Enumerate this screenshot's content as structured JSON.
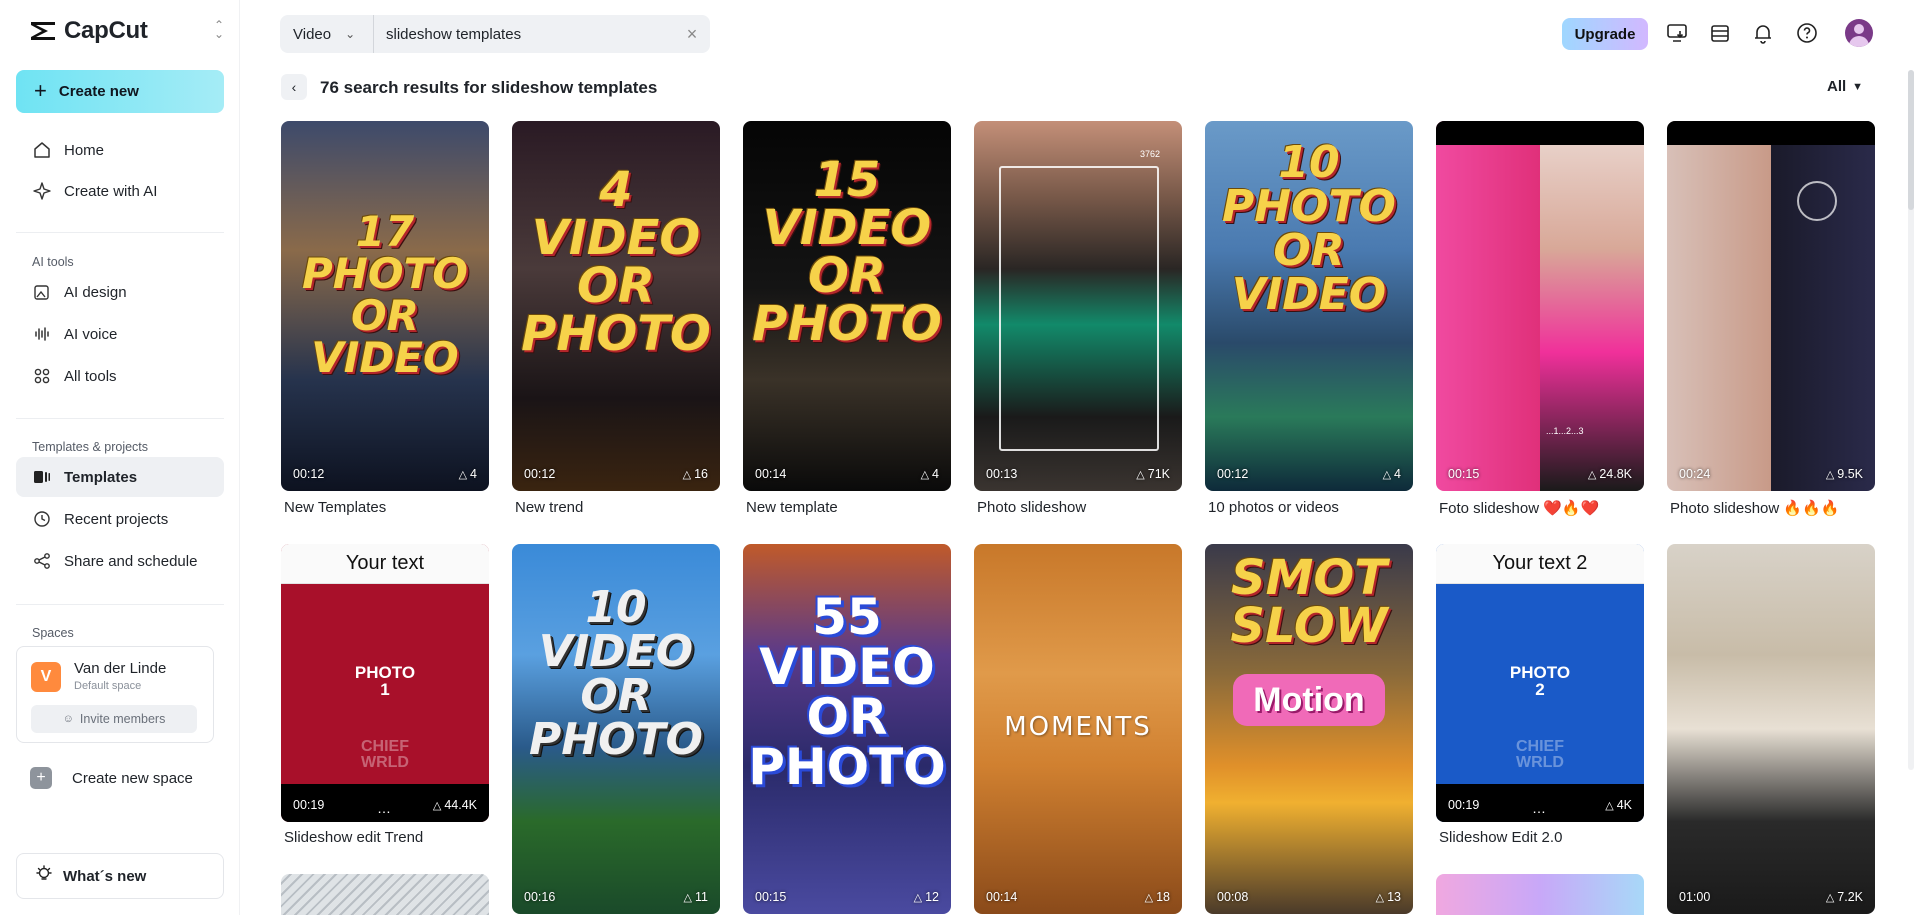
{
  "app": {
    "name": "CapCut",
    "colors": {
      "accent_cyan": "#6fe3f3",
      "upgrade_gradient_start": "#9fd7ff",
      "upgrade_gradient_end": "#d2b8ff",
      "space_avatar": "#ff8a3d"
    }
  },
  "sidebar": {
    "create_label": "Create new",
    "nav": [
      {
        "label": "Home",
        "icon": "home-icon"
      },
      {
        "label": "Create with AI",
        "icon": "sparkle-icon"
      }
    ],
    "ai_tools_label": "AI tools",
    "ai_tools": [
      {
        "label": "AI design",
        "icon": "image-sparkle-icon"
      },
      {
        "label": "AI voice",
        "icon": "waveform-icon"
      },
      {
        "label": "All tools",
        "icon": "grid-icon"
      }
    ],
    "projects_label": "Templates & projects",
    "projects": [
      {
        "label": "Templates",
        "icon": "templates-icon",
        "active": true
      },
      {
        "label": "Recent projects",
        "icon": "clock-icon"
      },
      {
        "label": "Share and schedule",
        "icon": "share-icon"
      }
    ],
    "spaces_label": "Spaces",
    "space": {
      "initial": "V",
      "name": "Van der Linde",
      "subtitle": "Default space",
      "invite_label": "Invite members"
    },
    "new_space_label": "Create new space",
    "whats_new_label": "What´s new"
  },
  "header": {
    "search_type": "Video",
    "search_value": "slideshow templates",
    "upgrade_label": "Upgrade",
    "icons": [
      "monitor-download-icon",
      "inbox-icon",
      "bell-icon",
      "help-icon",
      "user-avatar"
    ]
  },
  "results": {
    "title": "76 search results for slideshow templates",
    "filter_label": "All"
  },
  "cards": [
    {
      "title": "New Templates",
      "duration": "00:12",
      "uses": "4",
      "thumb_text": "17\nPHOTO\nOR\nVIDEO"
    },
    {
      "title": "New trend",
      "duration": "00:12",
      "uses": "16",
      "thumb_text": "4\nVIDEO\nOR\nPHOTO"
    },
    {
      "title": "New template",
      "duration": "00:14",
      "uses": "4",
      "thumb_text": "15\nVIDEO\nOR\nPHOTO"
    },
    {
      "title": "Photo slideshow",
      "duration": "00:13",
      "uses": "71K",
      "thumb_text": "",
      "overlay_text": "3762"
    },
    {
      "title": "10 photos or videos",
      "duration": "00:12",
      "uses": "4",
      "thumb_text": "10\nPHOTO\nOR\nVIDEO"
    },
    {
      "title": "Foto slideshow ❤️🔥❤️",
      "duration": "00:15",
      "uses": "24.8K",
      "thumb_text": "",
      "overlay_text": "...1...2...3"
    },
    {
      "title": "Photo slideshow 🔥🔥🔥",
      "duration": "00:24",
      "uses": "9.5K",
      "thumb_text": ""
    },
    {
      "title": "Slideshow edit Trend",
      "duration": "00:19",
      "uses": "44.4K",
      "header_text": "Your text",
      "photo_label": "PHOTO\n1",
      "watermark": "CHIEF\nWRLD"
    },
    {
      "title": "",
      "duration": "00:16",
      "uses": "11",
      "thumb_text": "10\nVIDEO\nOR\nPHOTO"
    },
    {
      "title": "",
      "duration": "00:15",
      "uses": "12",
      "thumb_text": "55\nVIDEO\nOR\nPHOTO"
    },
    {
      "title": "",
      "duration": "00:14",
      "uses": "18",
      "thumb_text": "MOMENTS"
    },
    {
      "title": "",
      "duration": "00:08",
      "uses": "13",
      "thumb_text": "SMOT\nSLOW",
      "badge_text": "Motion"
    },
    {
      "title": "Slideshow Edit 2.0",
      "duration": "00:19",
      "uses": "4K",
      "header_text": "Your text 2",
      "photo_label": "PHOTO\n2",
      "watermark": "CHIEF\nWRLD"
    },
    {
      "title": "",
      "duration": "01:00",
      "uses": "7.2K",
      "thumb_text": ""
    }
  ]
}
